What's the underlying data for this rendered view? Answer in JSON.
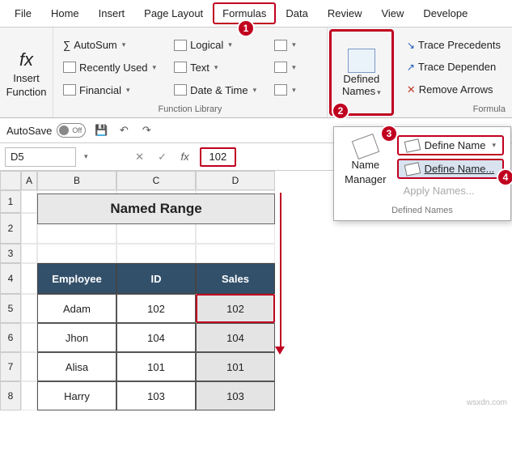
{
  "tabs": [
    "File",
    "Home",
    "Insert",
    "Page Layout",
    "Formulas",
    "Data",
    "Review",
    "View",
    "Develope"
  ],
  "active_tab_index": 4,
  "ribbon": {
    "insert_function": {
      "fx": "fx",
      "l1": "Insert",
      "l2": "Function"
    },
    "col1": {
      "a": "AutoSum",
      "b": "Recently Used",
      "c": "Financial"
    },
    "col2": {
      "a": "Logical",
      "b": "Text",
      "c": "Date & Time"
    },
    "group_label": "Function Library",
    "defined": {
      "l1": "Defined",
      "l2": "Names"
    },
    "trace": {
      "a": "Trace Precedents",
      "b": "Trace Dependen",
      "c": "Remove Arrows"
    },
    "group_label2": "Formula"
  },
  "qat": {
    "autosave": "AutoSave",
    "off": "Off"
  },
  "formula_bar": {
    "name": "D5",
    "value": "102"
  },
  "columns": [
    "A",
    "B",
    "C",
    "D"
  ],
  "rows": [
    "1",
    "2",
    "3",
    "4",
    "5",
    "6",
    "7",
    "8"
  ],
  "title_cell": "Named Range",
  "headers": {
    "b": "Employee",
    "c": "ID",
    "d": "Sales"
  },
  "data_rows": [
    {
      "emp": "Adam",
      "id": "102",
      "sales": "102"
    },
    {
      "emp": "Jhon",
      "id": "104",
      "sales": "104"
    },
    {
      "emp": "Alisa",
      "id": "101",
      "sales": "101"
    },
    {
      "emp": "Harry",
      "id": "103",
      "sales": "103"
    }
  ],
  "dropdown": {
    "name_manager": {
      "l1": "Name",
      "l2": "Manager"
    },
    "item1": "Define Name",
    "item2": "Define Name...",
    "item3": "Apply Names...",
    "label": "Defined Names"
  },
  "markers": {
    "m1": "1",
    "m2": "2",
    "m3": "3",
    "m4": "4"
  },
  "watermark": "wsxdn.com"
}
